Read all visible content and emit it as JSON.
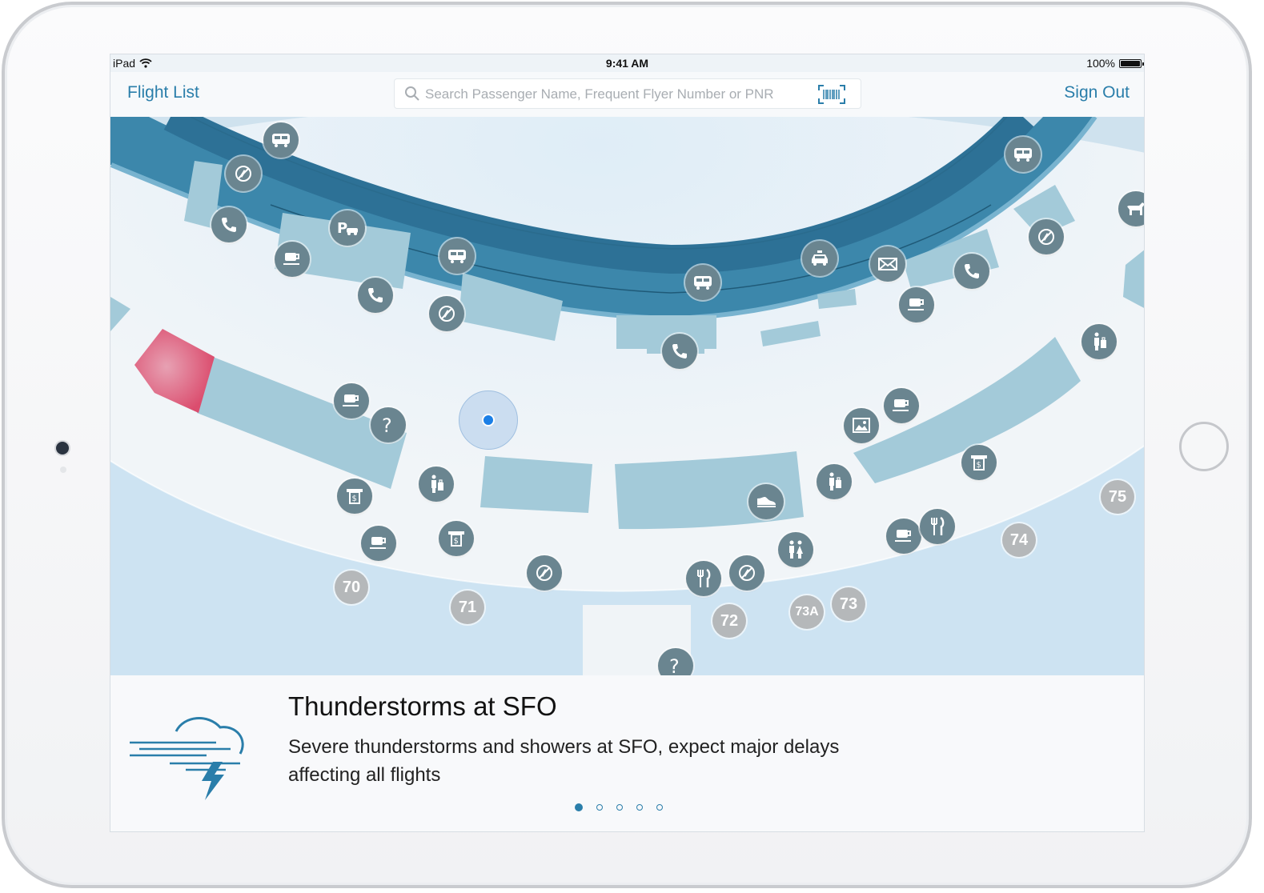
{
  "status_bar": {
    "device": "iPad",
    "time": "9:41 AM",
    "battery": "100%",
    "battery_level": 1.0
  },
  "nav": {
    "flight_list": "Flight List",
    "sign_out": "Sign Out"
  },
  "search": {
    "placeholder": "Search Passenger Name, Frequent Flyer Number or PNR"
  },
  "map": {
    "gates": [
      "70",
      "71",
      "72",
      "73A",
      "73",
      "74",
      "75"
    ],
    "amenity_icons": [
      "bus-icon",
      "no-smoking-icon",
      "phone-icon",
      "parking-icon",
      "coffee-icon",
      "taxi-icon",
      "mail-icon",
      "pet-relief-icon",
      "help-icon",
      "atm-icon",
      "baggage-icon",
      "restroom-icon",
      "restaurant-icon",
      "gallery-icon",
      "shoe-shine-icon"
    ]
  },
  "alert": {
    "title": "Thunderstorms at SFO",
    "body": "Severe thunderstorms and showers at SFO, expect major delays affecting all flights"
  },
  "pager": {
    "pages": 5,
    "active": 1
  },
  "colors": {
    "accent": "#2a7eaa",
    "road": "#3a86aa",
    "building": "#a3cad9",
    "gate_badge": "#b5b8ba",
    "pin": "#6a8590",
    "highlight": "#df5a78"
  }
}
